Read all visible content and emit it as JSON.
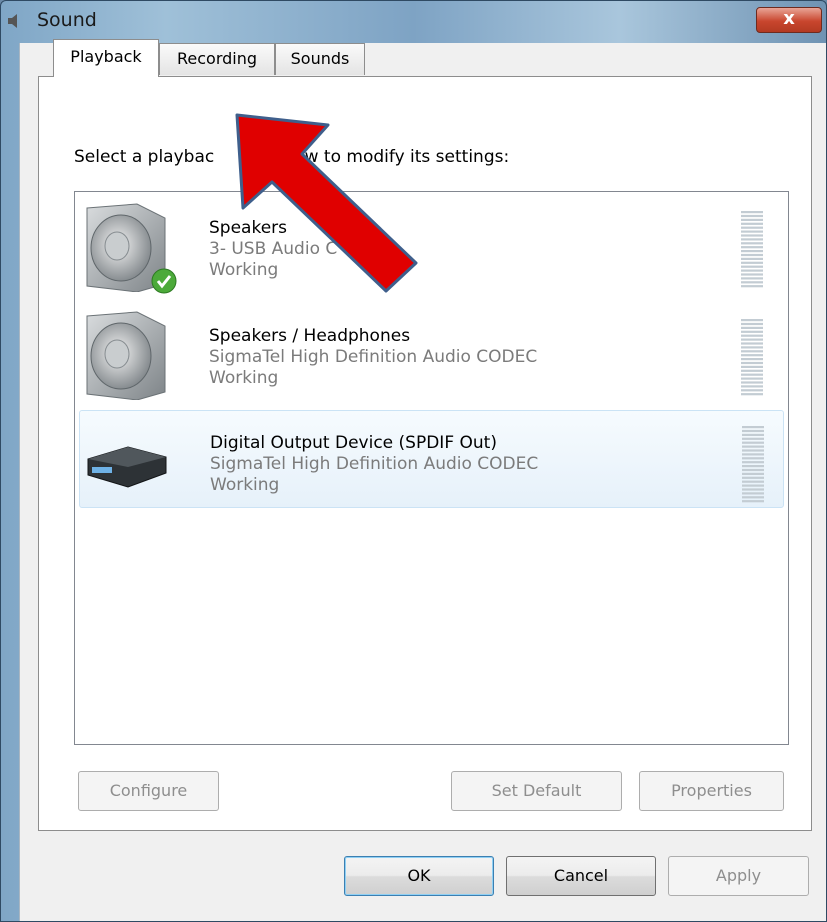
{
  "window": {
    "title": "Sound",
    "close_label": "x"
  },
  "tabs": [
    {
      "label": "Playback",
      "active": true
    },
    {
      "label": "Recording",
      "active": false
    },
    {
      "label": "Sounds",
      "active": false
    }
  ],
  "instruction": "Select a playbac          below to modify its settings:",
  "devices": [
    {
      "name": "Speakers",
      "driver": "3- USB Audio C",
      "status": "Working",
      "icon": "speaker-icon",
      "is_default": true
    },
    {
      "name": "Speakers / Headphones",
      "driver": "SigmaTel High Definition Audio CODEC",
      "status": "Working",
      "icon": "speaker-icon",
      "is_default": false
    },
    {
      "name": "Digital Output Device (SPDIF Out)",
      "driver": "SigmaTel High Definition Audio CODEC",
      "status": "Working",
      "icon": "digital-output-device-icon",
      "is_default": false,
      "selected": true
    }
  ],
  "buttons": {
    "configure": "Configure",
    "set_default": "Set Default",
    "properties": "Properties",
    "ok": "OK",
    "cancel": "Cancel",
    "apply": "Apply"
  },
  "colors": {
    "annotation_arrow": "#e00000",
    "selection": "#e6f1fa"
  }
}
